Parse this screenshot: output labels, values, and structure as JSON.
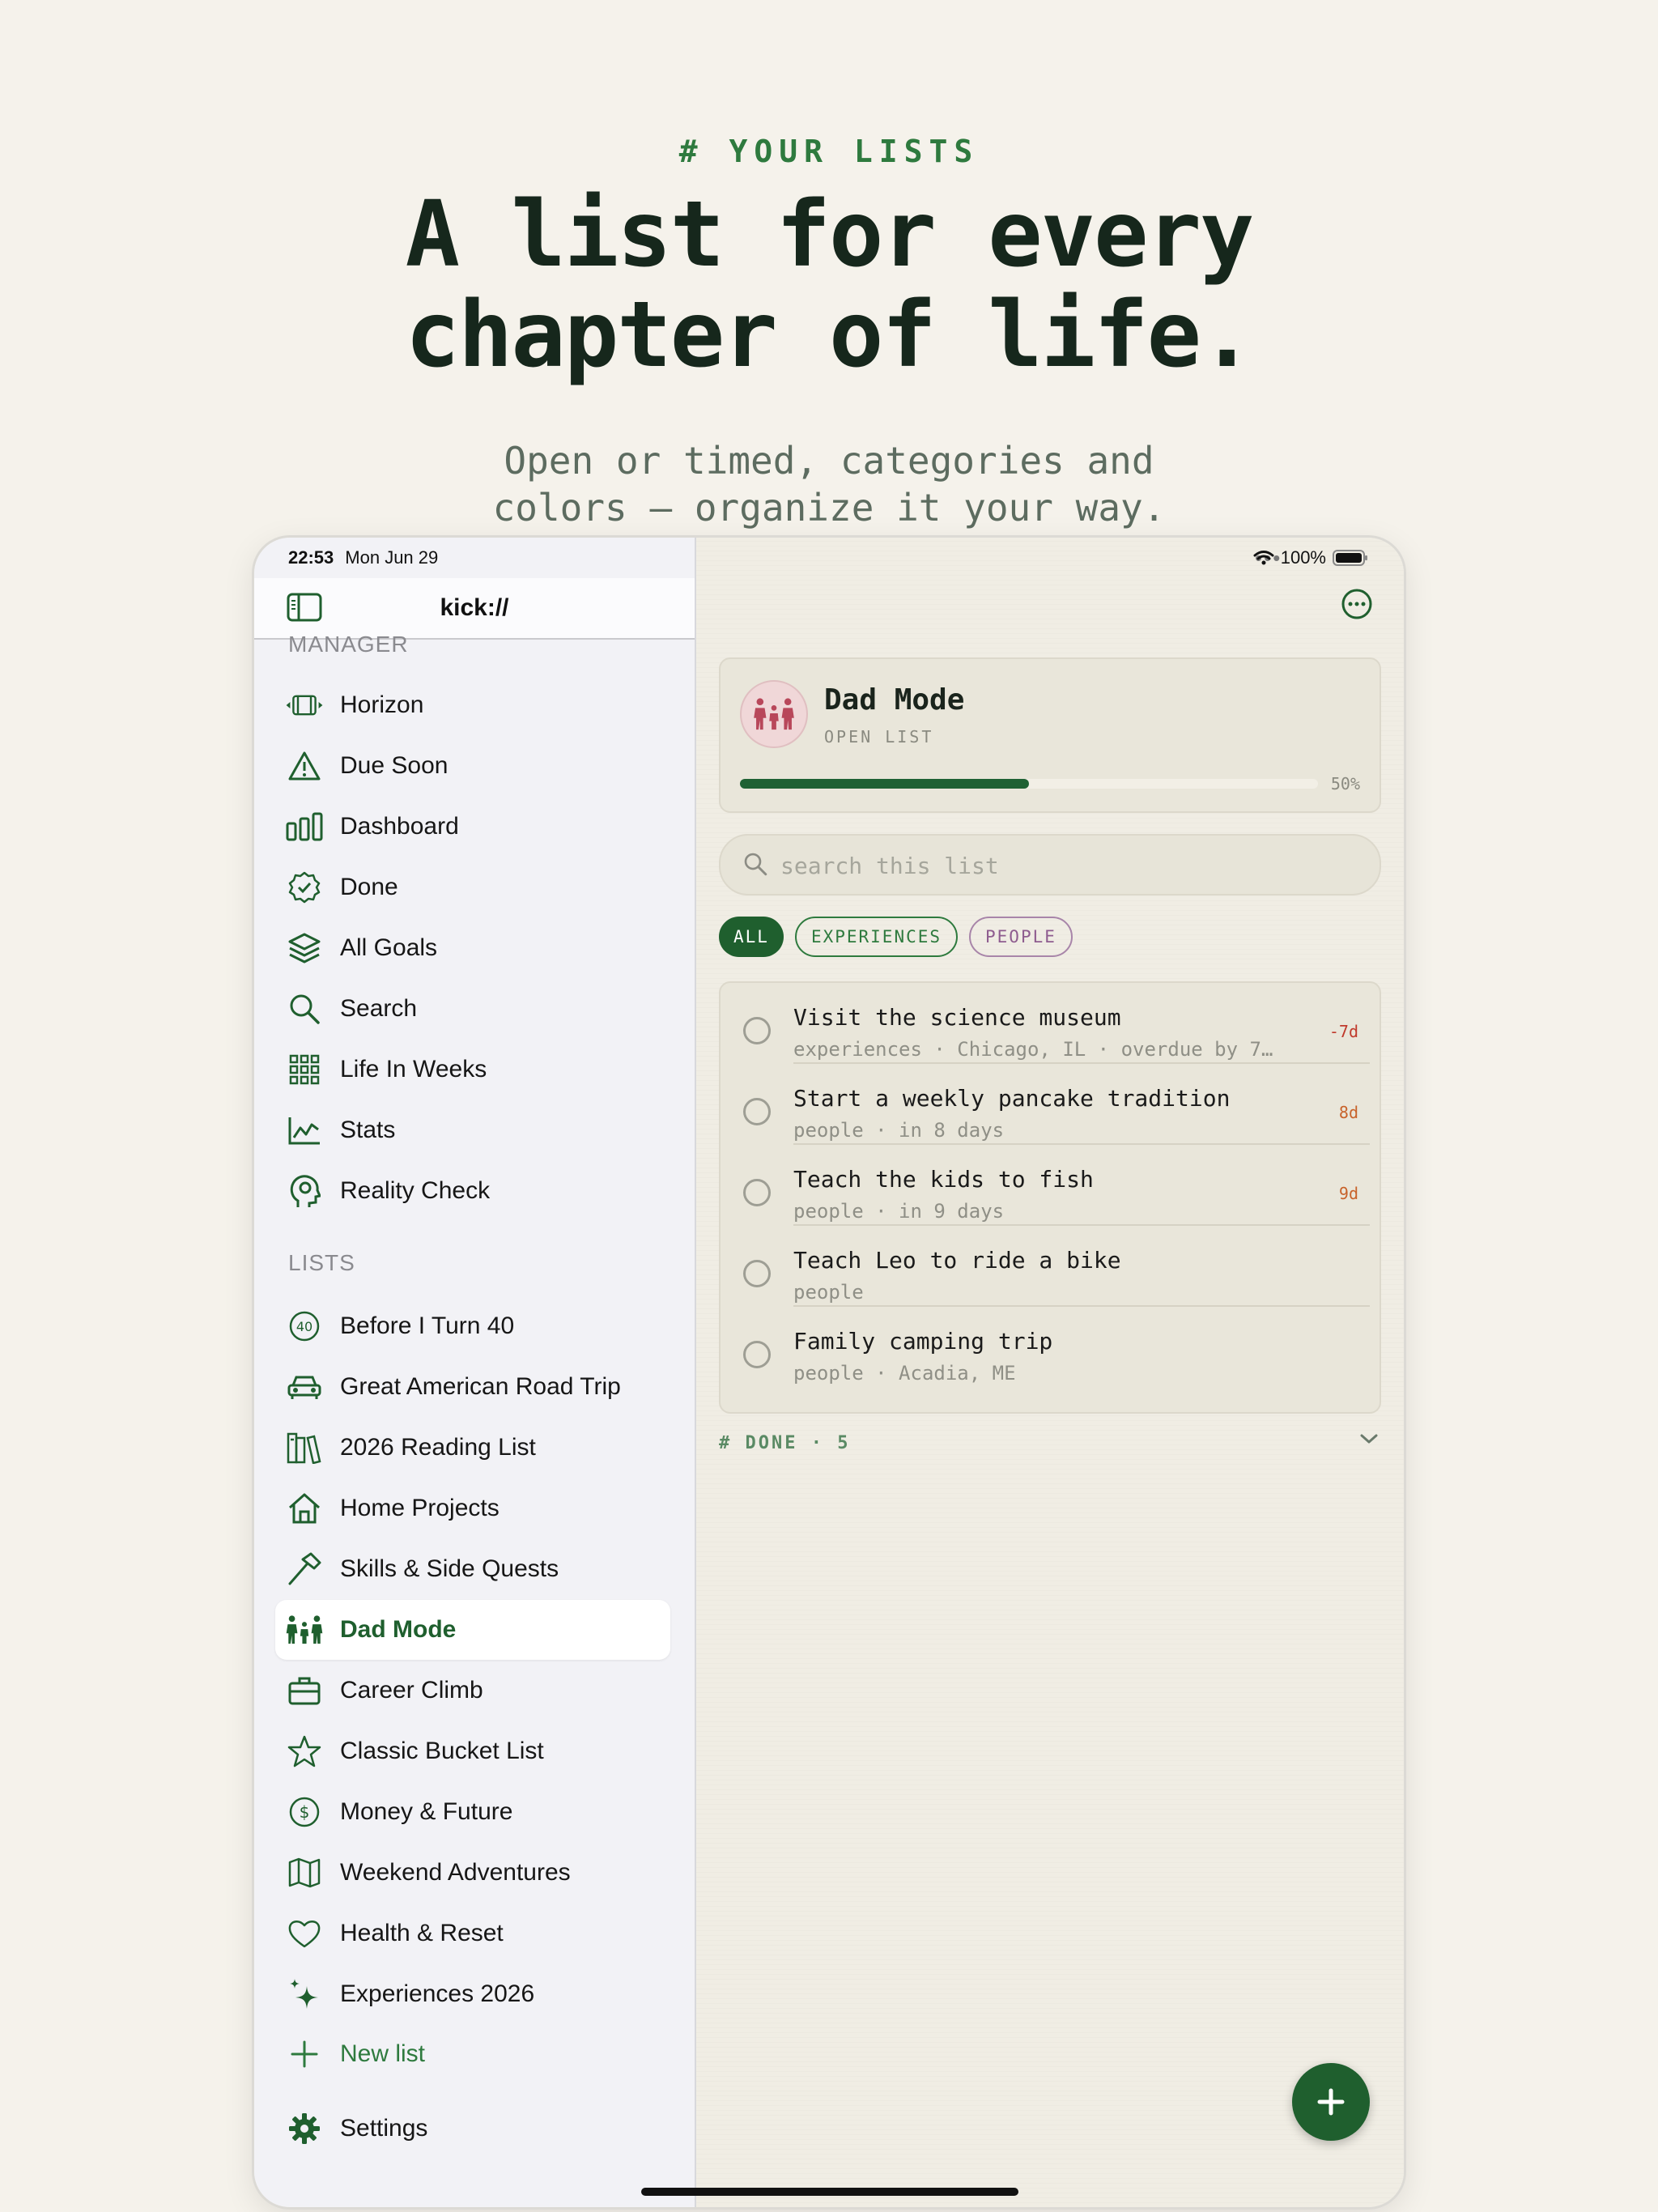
{
  "hero": {
    "eyebrow": "# YOUR LISTS",
    "title_line1": "A list for every",
    "title_line2": "chapter of life.",
    "subtitle_line1": "Open or timed, categories and",
    "subtitle_line2": "colors — organize it your way."
  },
  "status_bar": {
    "time": "22:53",
    "date": "Mon Jun 29",
    "battery": "100%"
  },
  "sidebar": {
    "title": "kick://",
    "section_manager": "MANAGER",
    "manager_items": [
      {
        "label": "Horizon",
        "icon": "horizon-icon"
      },
      {
        "label": "Due Soon",
        "icon": "warning-icon"
      },
      {
        "label": "Dashboard",
        "icon": "dashboard-icon"
      },
      {
        "label": "Done",
        "icon": "done-badge-icon"
      },
      {
        "label": "All Goals",
        "icon": "layers-icon"
      },
      {
        "label": "Search",
        "icon": "search-icon"
      },
      {
        "label": "Life In Weeks",
        "icon": "grid-icon"
      },
      {
        "label": "Stats",
        "icon": "chart-icon"
      },
      {
        "label": "Reality Check",
        "icon": "head-icon"
      }
    ],
    "section_lists": "LISTS",
    "list_items": [
      {
        "label": "Before I Turn 40",
        "icon": "forty-icon"
      },
      {
        "label": "Great American Road Trip",
        "icon": "car-icon"
      },
      {
        "label": "2026 Reading List",
        "icon": "books-icon"
      },
      {
        "label": "Home Projects",
        "icon": "house-icon"
      },
      {
        "label": "Skills & Side Quests",
        "icon": "hammer-icon"
      },
      {
        "label": "Dad Mode",
        "icon": "family-icon",
        "active": true
      },
      {
        "label": "Career Climb",
        "icon": "briefcase-icon"
      },
      {
        "label": "Classic Bucket List",
        "icon": "star-icon"
      },
      {
        "label": "Money & Future",
        "icon": "dollar-icon"
      },
      {
        "label": "Weekend Adventures",
        "icon": "map-icon"
      },
      {
        "label": "Health & Reset",
        "icon": "heart-icon"
      },
      {
        "label": "Experiences 2026",
        "icon": "sparkle-icon"
      }
    ],
    "new_list": "New list",
    "settings": "Settings"
  },
  "list_card": {
    "title": "Dad Mode",
    "type": "OPEN LIST",
    "progress": 50,
    "progress_label": "50%"
  },
  "search": {
    "placeholder": "search this list"
  },
  "chips": [
    "ALL",
    "EXPERIENCES",
    "PEOPLE"
  ],
  "goals": [
    {
      "title": "Visit the science museum",
      "meta": "experiences · Chicago, IL · overdue by 7…",
      "badge": "-7d",
      "badge_color": "#c0392b"
    },
    {
      "title": "Start a weekly pancake tradition",
      "meta": "people · in 8 days",
      "badge": "8d",
      "badge_color": "#c8622a"
    },
    {
      "title": "Teach the kids to fish",
      "meta": "people · in 9 days",
      "badge": "9d",
      "badge_color": "#c8622a"
    },
    {
      "title": "Teach Leo to ride a bike",
      "meta": "people",
      "badge": "",
      "badge_color": ""
    },
    {
      "title": "Family camping trip",
      "meta": "people · Acadia, ME",
      "badge": "",
      "badge_color": ""
    }
  ],
  "done_section": "# DONE · 5",
  "colors": {
    "accent": "#1f5f2e",
    "background": "#f5f2eb",
    "people_chip": "#8e5c8f"
  }
}
